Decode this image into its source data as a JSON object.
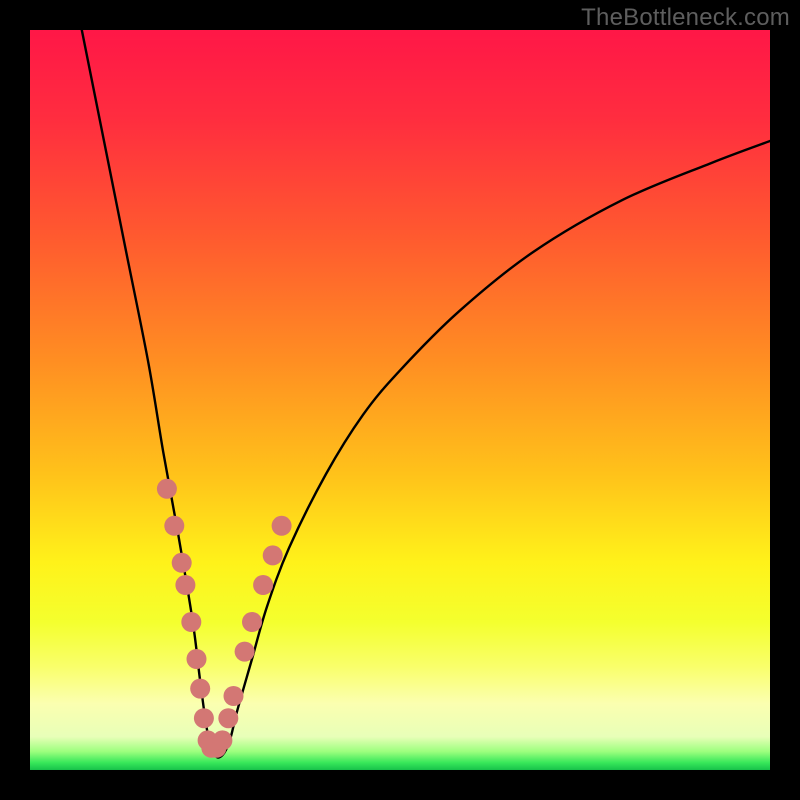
{
  "watermark": "TheBottleneck.com",
  "colors": {
    "black": "#000000",
    "curve": "#000000",
    "dot": "#d37774",
    "gradient_stops": [
      {
        "offset": 0.0,
        "color": "#ff1747"
      },
      {
        "offset": 0.12,
        "color": "#ff2d3f"
      },
      {
        "offset": 0.28,
        "color": "#ff5a2f"
      },
      {
        "offset": 0.45,
        "color": "#ff8f22"
      },
      {
        "offset": 0.6,
        "color": "#ffc21a"
      },
      {
        "offset": 0.72,
        "color": "#fff21a"
      },
      {
        "offset": 0.8,
        "color": "#f4ff2e"
      },
      {
        "offset": 0.86,
        "color": "#f9ff6a"
      },
      {
        "offset": 0.91,
        "color": "#fbffb0"
      },
      {
        "offset": 0.955,
        "color": "#e8ffb8"
      },
      {
        "offset": 0.975,
        "color": "#9dff7e"
      },
      {
        "offset": 0.99,
        "color": "#38e85a"
      },
      {
        "offset": 1.0,
        "color": "#17c24a"
      }
    ]
  },
  "chart_data": {
    "type": "line",
    "title": "",
    "xlabel": "",
    "ylabel": "",
    "xlim": [
      0,
      100
    ],
    "ylim": [
      0,
      100
    ],
    "grid": false,
    "legend": false,
    "comment": "Axes unlabeled; values are inferred percentages of canvas. y=0 at bottom (good/green), y=100 at top (bad/red). Curve hits minimum near x≈24.",
    "series": [
      {
        "name": "bottleneck-curve",
        "x": [
          7,
          10,
          13,
          16,
          18,
          20,
          22,
          23,
          24,
          25,
          26,
          27,
          28,
          30,
          32,
          35,
          40,
          45,
          50,
          58,
          68,
          80,
          92,
          100
        ],
        "y": [
          100,
          85,
          70,
          55,
          43,
          32,
          20,
          12,
          5,
          2,
          2,
          4,
          8,
          15,
          22,
          30,
          40,
          48,
          54,
          62,
          70,
          77,
          82,
          85
        ]
      }
    ],
    "highlight_points": {
      "comment": "Salmon dots clustered near curve minimum",
      "points": [
        {
          "x": 18.5,
          "y": 38
        },
        {
          "x": 19.5,
          "y": 33
        },
        {
          "x": 20.5,
          "y": 28
        },
        {
          "x": 21.0,
          "y": 25
        },
        {
          "x": 21.8,
          "y": 20
        },
        {
          "x": 22.5,
          "y": 15
        },
        {
          "x": 23.0,
          "y": 11
        },
        {
          "x": 23.5,
          "y": 7
        },
        {
          "x": 24.0,
          "y": 4
        },
        {
          "x": 24.5,
          "y": 3
        },
        {
          "x": 25.2,
          "y": 3
        },
        {
          "x": 26.0,
          "y": 4
        },
        {
          "x": 26.8,
          "y": 7
        },
        {
          "x": 27.5,
          "y": 10
        },
        {
          "x": 29.0,
          "y": 16
        },
        {
          "x": 30.0,
          "y": 20
        },
        {
          "x": 31.5,
          "y": 25
        },
        {
          "x": 32.8,
          "y": 29
        },
        {
          "x": 34.0,
          "y": 33
        }
      ]
    }
  }
}
